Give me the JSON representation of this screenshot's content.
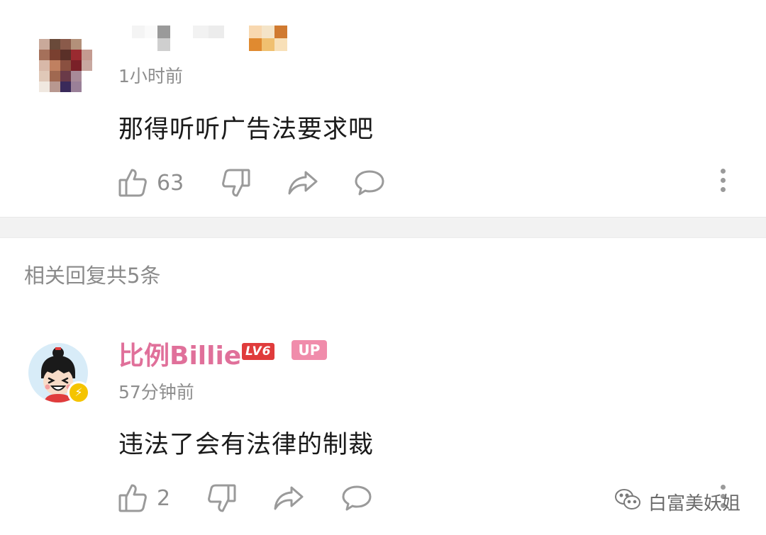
{
  "comments": [
    {
      "time": "1小时前",
      "text": "那得听听广告法要求吧",
      "likes": "63"
    },
    {
      "username": "比例Billie",
      "level": "LV6",
      "up_badge": "UP",
      "time": "57分钟前",
      "text": "违法了会有法律的制裁",
      "likes": "2"
    }
  ],
  "replies_header": "相关回复共5条",
  "watermark": "白富美妖姐",
  "icons": [
    "thumbs-up-icon",
    "thumbs-down-icon",
    "share-icon",
    "comment-icon",
    "more-vertical-icon",
    "wechat-icon"
  ],
  "colors": {
    "username": "#e0709a",
    "level_badge": "#e03c3c",
    "up_badge": "#f08cab",
    "muted_text": "#8e8e8e",
    "body_text": "#1a1a1a"
  }
}
